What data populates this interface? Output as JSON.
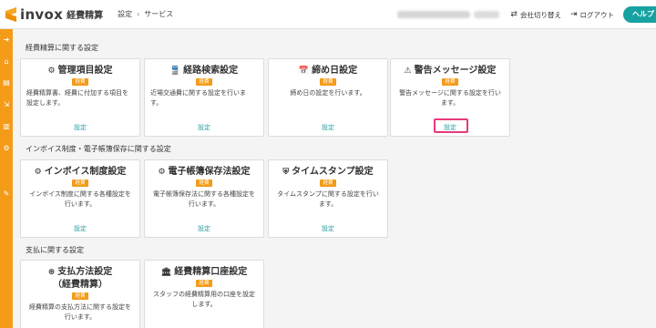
{
  "header": {
    "logo": "invox",
    "logo_sub": "経費精算",
    "breadcrumb": [
      "設定",
      "サービス"
    ],
    "switch_company": "会社切り替え",
    "logout": "ログアウト",
    "help": "ヘルプ"
  },
  "sections": [
    {
      "title": "経費精算に関する設定",
      "cards": [
        {
          "icon": "gears-icon",
          "glyph": "⚙",
          "title": "管理項目設定",
          "badge": "経費",
          "desc": "経費精算書、経費に付加する項目を設定します。",
          "link": "設定"
        },
        {
          "icon": "train-icon",
          "glyph": "🚆",
          "title": "経路検索設定",
          "badge": "経費",
          "desc": "近場交通費に関する設定を行います。",
          "link": "設定"
        },
        {
          "icon": "calendar-icon",
          "glyph": "📅",
          "title": "締め日設定",
          "badge": "経費",
          "desc": "締め日の設定を行います。",
          "link": "設定"
        },
        {
          "icon": "warning-icon",
          "glyph": "⚠",
          "title": "警告メッセージ設定",
          "badge": "経費",
          "desc": "警告メッセージに関する設定を行います。",
          "link": "設定"
        }
      ]
    },
    {
      "title": "インボイス制度・電子帳簿保存に関する設定",
      "cards": [
        {
          "icon": "gears-icon",
          "glyph": "⚙",
          "title": "インボイス制度設定",
          "badge": "経費",
          "desc": "インボイス制度に関する各種設定を行います。",
          "link": "設定"
        },
        {
          "icon": "gears-icon",
          "glyph": "⚙",
          "title": "電子帳簿保存法設定",
          "badge": "経費",
          "desc": "電子帳簿保存法に関する各種設定を行います。",
          "link": "設定"
        },
        {
          "icon": "shield-icon",
          "glyph": "⛨",
          "title": "タイムスタンプ設定",
          "badge": "経費",
          "desc": "タイムスタンプに関する設定を行います。",
          "link": "設定"
        }
      ]
    },
    {
      "title": "支払に関する設定",
      "cards": [
        {
          "icon": "payment-icon",
          "glyph": "⊛",
          "title": "支払方法設定",
          "title2": "（経費精算）",
          "badge": "経費",
          "desc": "経費精算の支払方法に関する設定を行います。"
        },
        {
          "icon": "bank-icon",
          "glyph": "🏛",
          "title": "経費精算口座設定",
          "badge": "経費",
          "desc": "スタッフの経費精算用の口座を設定します。"
        }
      ]
    }
  ],
  "colors": {
    "accent": "#f49b18",
    "link": "#2b9ea0",
    "help": "#17a2a2",
    "highlight": "#e8397d"
  }
}
